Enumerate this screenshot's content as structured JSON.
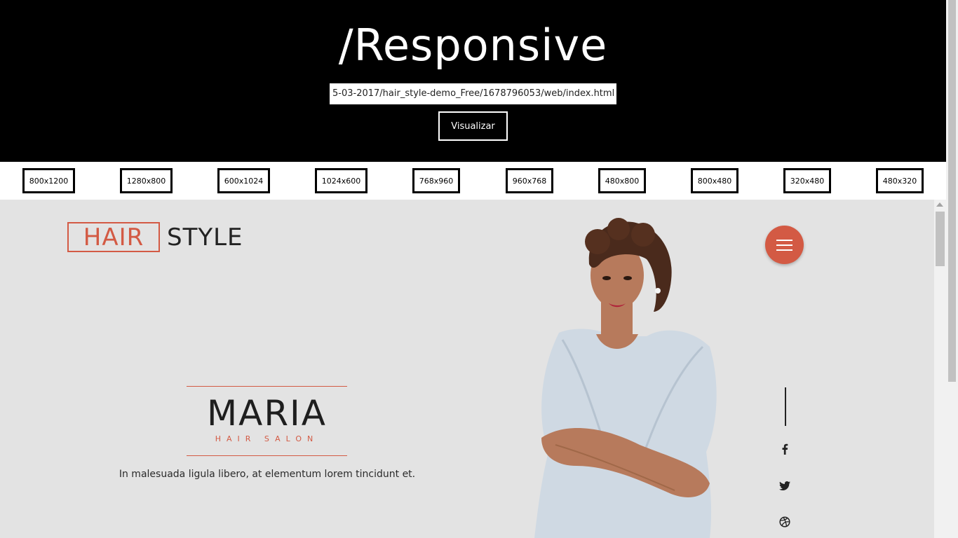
{
  "header": {
    "title": "/Responsive",
    "url_value": "5-03-2017/hair_style-demo_Free/1678796053/web/index.html",
    "view_button": "Visualizar"
  },
  "resolutions": [
    "800x1200",
    "1280x800",
    "600x1024",
    "1024x600",
    "768x960",
    "960x768",
    "480x800",
    "800x480",
    "320x480",
    "480x320"
  ],
  "site": {
    "logo_hair": "HAIR",
    "logo_style": "STYLE",
    "brand_name": "MARIA",
    "brand_sub": "HAIR SALON",
    "tagline": "In malesuada ligula libero, at elementum lorem tincidunt et.",
    "accent_color": "#d35a44",
    "social": [
      "facebook-icon",
      "twitter-icon",
      "dribbble-icon"
    ]
  }
}
